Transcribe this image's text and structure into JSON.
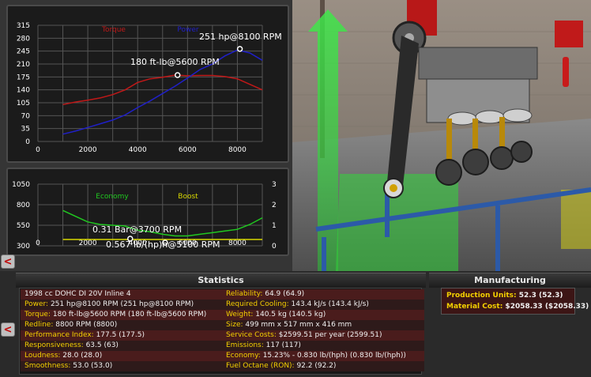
{
  "charts": {
    "power_torque": {
      "type": "line",
      "legend": [
        "Torque",
        "Power"
      ],
      "y_ticks": [
        "315",
        "280",
        "245",
        "210",
        "175",
        "140",
        "105",
        "70",
        "35",
        "0"
      ],
      "x_ticks": [
        "0",
        "2000",
        "4000",
        "6000",
        "8000"
      ],
      "ylim": [
        0,
        315
      ],
      "xlim": [
        0,
        9000
      ],
      "annotations": {
        "power": "251 hp@8100 RPM",
        "torque": "180 ft-lb@5600 RPM"
      },
      "colors": {
        "torque": "#c01818",
        "power": "#2020c8",
        "grid": "#555555",
        "label": "#ffffff"
      }
    },
    "economy_boost": {
      "type": "line",
      "legend": [
        "Economy",
        "Boost"
      ],
      "y_ticks_left": [
        "1050",
        "800",
        "550",
        "300"
      ],
      "y_ticks_right": [
        "3",
        "2",
        "1",
        "0"
      ],
      "x_ticks": [
        "0",
        "2000",
        "4000",
        "6000",
        "8000"
      ],
      "ylim_left": [
        300,
        1050
      ],
      "ylim_right": [
        0,
        3
      ],
      "xlim": [
        0,
        9000
      ],
      "annotations": {
        "boost": "0.31 Bar@3700 RPM",
        "economy": "0.567 lb/(hp)h@5100 RPM"
      },
      "colors": {
        "economy": "#20c820",
        "boost": "#d8d800"
      }
    }
  },
  "chart_data": [
    {
      "type": "line",
      "x": [
        1000,
        1500,
        2000,
        2500,
        3000,
        3500,
        4000,
        4500,
        5000,
        5500,
        6000,
        6500,
        7000,
        7500,
        8000,
        8500,
        9000
      ],
      "series": [
        {
          "name": "Torque",
          "values": [
            100,
            107,
            112,
            118,
            127,
            140,
            160,
            170,
            174,
            180,
            178,
            179,
            179,
            176,
            170,
            155,
            140
          ]
        },
        {
          "name": "Power",
          "values": [
            20,
            28,
            38,
            48,
            58,
            72,
            92,
            110,
            130,
            150,
            172,
            195,
            210,
            232,
            248,
            240,
            220
          ]
        }
      ],
      "xlim": [
        0,
        9000
      ],
      "ylim": [
        0,
        315
      ],
      "points": [
        {
          "series": "Power",
          "x": 8100,
          "y": 251
        },
        {
          "series": "Torque",
          "x": 5600,
          "y": 180
        }
      ]
    },
    {
      "type": "line",
      "x": [
        1000,
        1500,
        2000,
        2500,
        3000,
        3500,
        4000,
        4500,
        5000,
        5500,
        6000,
        6500,
        7000,
        7500,
        8000,
        8500,
        9000
      ],
      "series": [
        {
          "name": "Economy",
          "values": [
            730,
            660,
            590,
            560,
            550,
            540,
            490,
            470,
            440,
            420,
            420,
            440,
            460,
            480,
            500,
            560,
            640
          ]
        },
        {
          "name": "Boost",
          "values": [
            0,
            0,
            0,
            0,
            0,
            0,
            0,
            0,
            0,
            0,
            0,
            0,
            0,
            0,
            0,
            0,
            0
          ]
        }
      ],
      "ylim_left": [
        300,
        1050
      ],
      "ylim_right": [
        0,
        3
      ],
      "points": [
        {
          "series": "Boost",
          "x": 3700,
          "y": 0.31
        },
        {
          "series": "Economy",
          "x": 5100,
          "y": 440
        }
      ]
    }
  ],
  "nav": {
    "back_glyph": "<"
  },
  "statistics": {
    "title": "Statistics",
    "left": [
      {
        "label": "1998 cc DOHC DI 20V Inline 4",
        "value": "",
        "plain": true
      },
      {
        "label": "Power:",
        "value": " 251 hp@8100 RPM (251 hp@8100 RPM)"
      },
      {
        "label": "Torque:",
        "value": " 180 ft-lb@5600 RPM (180 ft-lb@5600 RPM)"
      },
      {
        "label": "Redline:",
        "value": " 8800 RPM (8800)"
      },
      {
        "label": "Performance Index:",
        "value": " 177.5 (177.5)"
      },
      {
        "label": "Responsiveness:",
        "value": " 63.5 (63)"
      },
      {
        "label": "Loudness:",
        "value": " 28.0 (28.0)"
      },
      {
        "label": "Smoothness:",
        "value": " 53.0 (53.0)"
      }
    ],
    "right": [
      {
        "label": "Reliability:",
        "value": " 64.9 (64.9)"
      },
      {
        "label": "Required Cooling:",
        "value": " 143.4 kJ/s (143.4 kJ/s)"
      },
      {
        "label": "Weight:",
        "value": " 140.5 kg (140.5 kg)"
      },
      {
        "label": "Size:",
        "value": " 499 mm x 517 mm x 416 mm"
      },
      {
        "label": "Service Costs:",
        "value": " $2599.51 per year (2599.51)"
      },
      {
        "label": "Emissions:",
        "value": " 117 (117)"
      },
      {
        "label": "Economy:",
        "value": " 15.23% - 0.830 lb/(hph) (0.830 lb/(hph))"
      },
      {
        "label": "Fuel Octane (RON):",
        "value": " 92.2 (92.2)"
      }
    ]
  },
  "manufacturing": {
    "title": "Manufacturing",
    "rows": [
      {
        "label": "Production Units:",
        "value": " 52.3 (52.3)"
      },
      {
        "label": "Material Cost:",
        "value": " $2058.33 ($2058.33)"
      }
    ]
  }
}
